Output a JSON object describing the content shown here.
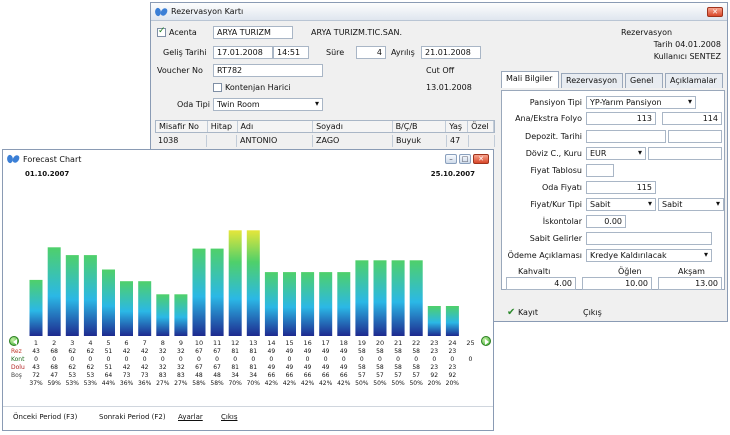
{
  "reservation": {
    "title": "Rezervasyon Kartı",
    "agency_checked": true,
    "agency_label": "Acenta",
    "agency_code": "ARYA TURIZM",
    "agency_name": "ARYA TURIZM.TIC.SAN.",
    "arrival_label": "Geliş Tarihi",
    "arrival_date": "17.01.2008",
    "arrival_time": "14:51",
    "duration_label": "Süre",
    "duration_value": "4",
    "departure_label": "Ayrılış",
    "departure_date": "21.01.2008",
    "voucher_label": "Voucher No",
    "voucher_value": "RT782",
    "cutoff_label": "Cut Off",
    "cutoff_date": "13.01.2008",
    "quota_label": "Kontenjan Harici",
    "quota_checked": false,
    "room_type_label": "Oda Tipi",
    "room_type_value": "Twin Room",
    "info_title": "Rezervasyon",
    "info_date": "Tarih 04.01.2008",
    "info_user": "Kullanıcı SENTEZ",
    "guest_columns": [
      "Misafir No",
      "Hitap",
      "Adı",
      "Soyadı",
      "B/Ç/B",
      "Yaş",
      "Özel"
    ],
    "guest_rows": [
      [
        "1038",
        "",
        "ANTONIO",
        "ZAGO",
        "Buyuk",
        "47",
        ""
      ]
    ],
    "tabs": [
      "Mali Bilgiler",
      "Rezervasyon",
      "Genel",
      "Açıklamalar"
    ],
    "board_label": "Pansiyon Tipi",
    "board_value": "YP-Yarım Pansiyon",
    "folio_label": "Ana/Ekstra Folyo",
    "folio_main": "113",
    "folio_extra": "114",
    "deposit_label": "Depozit. Tarihi",
    "currency_label": "Döviz C., Kuru",
    "currency_value": "EUR",
    "price_table_label": "Fiyat Tablosu",
    "room_price_label": "Oda Fiyatı",
    "room_price_value": "115",
    "price_type_label": "Fiyat/Kur Tipi",
    "price_type_1": "Sabit",
    "price_type_2": "Sabit",
    "discount_label": "İskontolar",
    "discount_value": "0.00",
    "fixed_income_label": "Sabit Gelirler",
    "payment_label": "Ödeme Açıklaması",
    "payment_value": "Kredye Kaldırılacak",
    "meal_headers": [
      "Kahvaltı",
      "Öğlen",
      "Akşam"
    ],
    "meal_values": [
      "4.00",
      "10.00",
      "13.00"
    ],
    "save_label": "Kayıt",
    "exit_label": "Çıkış"
  },
  "forecast": {
    "title": "Forecast Chart",
    "date_start": "01.10.2007",
    "date_end": "25.10.2007",
    "row_labels": [
      "Rez",
      "Kont",
      "Dolu",
      "Boş"
    ],
    "row_colors": [
      "#c0392b",
      "#1f6f1f",
      "#b22222",
      "#444444"
    ],
    "rez": [
      "43",
      "68",
      "62",
      "62",
      "51",
      "42",
      "42",
      "32",
      "32",
      "67",
      "67",
      "81",
      "81",
      "49",
      "49",
      "49",
      "49",
      "49",
      "58",
      "58",
      "58",
      "58",
      "23",
      "23"
    ],
    "kont": [
      "0",
      "0",
      "0",
      "0",
      "0",
      "0",
      "0",
      "0",
      "0",
      "0",
      "0",
      "0",
      "0",
      "0",
      "0",
      "0",
      "0",
      "0",
      "0",
      "0",
      "0",
      "0",
      "0",
      "0",
      "0"
    ],
    "dolu": [
      "43",
      "68",
      "62",
      "62",
      "51",
      "42",
      "42",
      "32",
      "32",
      "67",
      "67",
      "81",
      "81",
      "49",
      "49",
      "49",
      "49",
      "49",
      "58",
      "58",
      "58",
      "58",
      "23",
      "23"
    ],
    "bos": [
      "72",
      "47",
      "53",
      "53",
      "64",
      "73",
      "73",
      "83",
      "83",
      "48",
      "48",
      "34",
      "34",
      "66",
      "66",
      "66",
      "66",
      "66",
      "57",
      "57",
      "57",
      "57",
      "92",
      "92"
    ],
    "pct": [
      "37%",
      "59%",
      "53%",
      "53%",
      "44%",
      "36%",
      "36%",
      "27%",
      "27%",
      "58%",
      "58%",
      "70%",
      "70%",
      "42%",
      "42%",
      "42%",
      "42%",
      "42%",
      "50%",
      "50%",
      "50%",
      "50%",
      "20%",
      "20%"
    ],
    "prev_label": "Önceki Period (F3)",
    "next_label": "Sonraki Period (F2)",
    "settings_label": "Ayarlar",
    "exit_label": "Çıkış"
  },
  "chart_data": {
    "type": "bar",
    "categories": [
      "1",
      "2",
      "3",
      "4",
      "5",
      "6",
      "7",
      "8",
      "9",
      "10",
      "11",
      "12",
      "13",
      "14",
      "15",
      "16",
      "17",
      "18",
      "19",
      "20",
      "21",
      "22",
      "23",
      "24",
      "25"
    ],
    "values": [
      43,
      68,
      62,
      62,
      51,
      42,
      42,
      32,
      32,
      67,
      67,
      81,
      81,
      49,
      49,
      49,
      49,
      49,
      58,
      58,
      58,
      58,
      23,
      23,
      null
    ],
    "ylim": [
      0,
      115
    ],
    "grid": false,
    "colors": {
      "bar_bottom": "#1e2a8f",
      "bar_mid": "#2bb8e6",
      "bar_top_normal": "#4fd06a",
      "bar_top_high": "#e6e63a"
    }
  }
}
